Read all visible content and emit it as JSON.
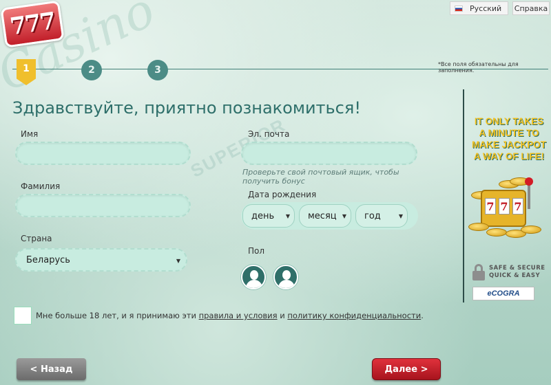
{
  "brand": {
    "logo_text": "777"
  },
  "topbar": {
    "language_label": "Русский",
    "help_label": "Справка"
  },
  "steps": [
    {
      "label": "1"
    },
    {
      "label": "2"
    },
    {
      "label": "3"
    }
  ],
  "required_note": "*Все поля обязательны для заполнения.",
  "page_title": "Здравствуйте, приятно познакомиться!",
  "form": {
    "first_name_label": "Имя",
    "last_name_label": "Фамилия",
    "country_label": "Страна",
    "country_value": "Беларусь",
    "email_label": "Эл. почта",
    "email_hint": "Проверьте свой почтовый ящик, чтобы получить бонус",
    "dob_label": "Дата рождения",
    "dob_day": "день",
    "dob_month": "месяц",
    "dob_year": "год",
    "gender_label": "Пол"
  },
  "terms": {
    "prefix": "Мне больше 18 лет, и я принимаю эти ",
    "link_terms": "правила и условия",
    "middle": " и ",
    "link_privacy": "политику конфиденциальности",
    "suffix": "."
  },
  "buttons": {
    "back": "< Назад",
    "next": "Далее >"
  },
  "promo": {
    "text": "IT ONLY TAKES A MINUTE TO MAKE JACKPOT A WAY OF LIFE!",
    "reel_symbol": "7"
  },
  "secure": {
    "line1": "SAFE & SECURE",
    "line2": "QUICK & EASY",
    "badge": "eCOGRA"
  },
  "colors": {
    "accent_teal": "#2e6f6a",
    "step_active": "#f0bf2c",
    "next_red": "#c21f2a"
  },
  "icons": [
    "flag-ru-icon",
    "male-avatar-icon",
    "female-avatar-icon",
    "lock-icon",
    "chevron-down-icon"
  ]
}
